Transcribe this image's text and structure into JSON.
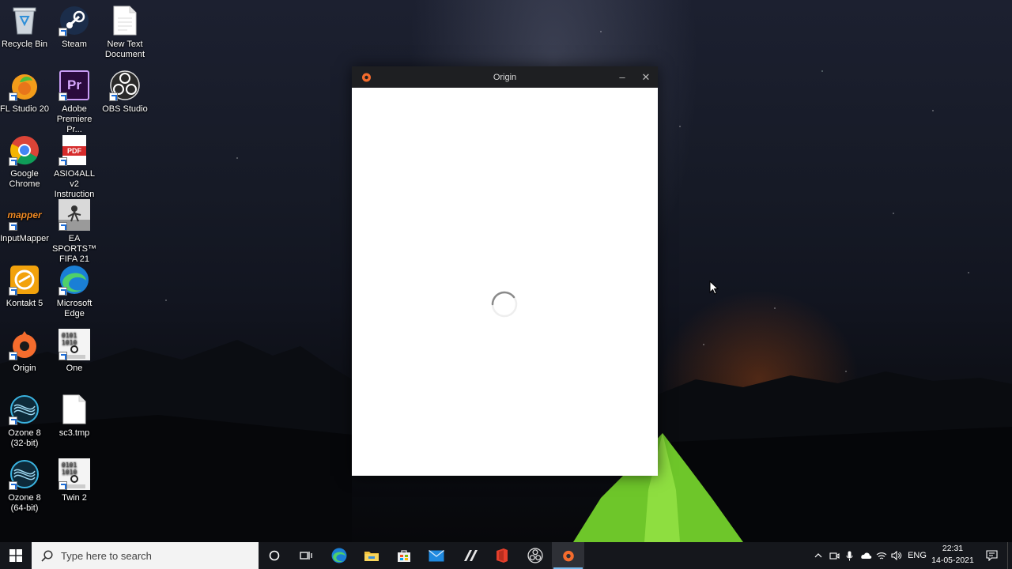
{
  "desktop": {
    "icons": [
      {
        "label": "Recycle Bin"
      },
      {
        "label": "Steam"
      },
      {
        "label": "New Text Document"
      },
      {
        "label": "FL Studio 20"
      },
      {
        "label": "Adobe Premiere Pr..."
      },
      {
        "label": "OBS Studio"
      },
      {
        "label": "Google Chrome"
      },
      {
        "label": "ASIO4ALL v2 Instruction ..."
      },
      {
        "label": "InputMapper"
      },
      {
        "label": "EA SPORTS™ FIFA 21"
      },
      {
        "label": "Kontakt 5"
      },
      {
        "label": "Microsoft Edge"
      },
      {
        "label": "Origin"
      },
      {
        "label": "One"
      },
      {
        "label": "Ozone 8 (32-bit)"
      },
      {
        "label": "sc3.tmp"
      },
      {
        "label": "Ozone 8 (64-bit)"
      },
      {
        "label": "Twin 2"
      }
    ],
    "badges": {
      "pdf": "PDF",
      "premiere": "Pr",
      "mapper": "mapper"
    }
  },
  "window": {
    "title": "Origin",
    "minimize_glyph": "–",
    "close_glyph": "✕",
    "accent": "#f56c2d"
  },
  "taskbar": {
    "search_placeholder": "Type here to search",
    "language": "ENG",
    "time": "22:31",
    "date": "14-05-2021"
  }
}
